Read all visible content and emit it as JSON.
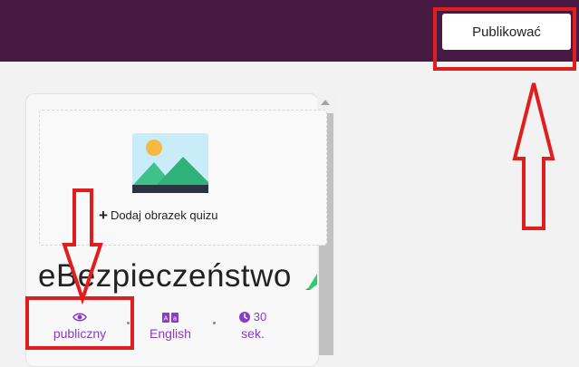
{
  "header": {
    "publish_label": "Publikować"
  },
  "quiz": {
    "add_image_label": "Dodaj obrazek quizu",
    "add_image_icon": "plus-icon",
    "title": "eBezpieczeństwo",
    "edit_icon": "pencil-icon"
  },
  "meta": {
    "visibility": {
      "icon": "eye-icon",
      "label": "publiczny"
    },
    "language": {
      "icon": "translate-icon",
      "label": "English"
    },
    "time": {
      "icon": "clock-icon",
      "value": "30",
      "unit": "sek."
    }
  },
  "colors": {
    "header_bg": "#461a42",
    "accent_purple": "#8a3cc4",
    "annotation_red": "#e01e1e",
    "pencil_green": "#2ecc71"
  }
}
